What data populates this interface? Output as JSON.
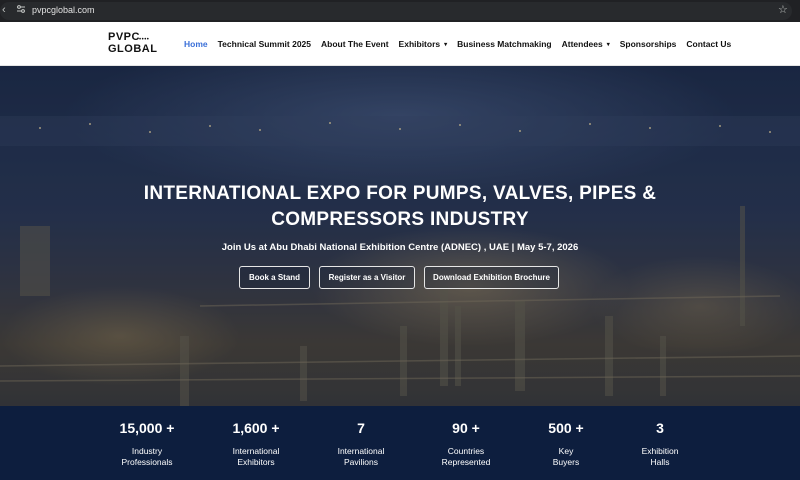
{
  "browser": {
    "url": "pvpcglobal.com"
  },
  "logo": {
    "line1": "PVPC",
    "dots": "••••",
    "line2": "GLOBAL"
  },
  "nav": {
    "items": [
      {
        "label": "Home",
        "active": true
      },
      {
        "label": "Technical Summit 2025"
      },
      {
        "label": "About The Event"
      },
      {
        "label": "Exhibitors",
        "dropdown": true
      },
      {
        "label": "Business Matchmaking"
      },
      {
        "label": "Attendees",
        "dropdown": true
      },
      {
        "label": "Sponsorships"
      },
      {
        "label": "Contact Us"
      }
    ],
    "caret": "▾"
  },
  "hero": {
    "title_line1": "INTERNATIONAL EXPO FOR PUMPS, VALVES, PIPES &",
    "title_line2": "COMPRESSORS INDUSTRY",
    "subtitle": "Join Us at Abu Dhabi National Exhibition Centre (ADNEC) , UAE | May 5-7, 2026",
    "buttons": [
      "Book a Stand",
      "Register as a Visitor",
      "Download Exhibition Brochure"
    ]
  },
  "stats": [
    {
      "value": "15,000 +",
      "label_line1": "Industry",
      "label_line2": "Professionals"
    },
    {
      "value": "1,600 +",
      "label_line1": "International",
      "label_line2": "Exhibitors"
    },
    {
      "value": "7",
      "label_line1": "International",
      "label_line2": "Pavilions"
    },
    {
      "value": "90 +",
      "label_line1": "Countries",
      "label_line2": "Represented"
    },
    {
      "value": "500 +",
      "label_line1": "Key",
      "label_line2": "Buyers"
    },
    {
      "value": "3",
      "label_line1": "Exhibition",
      "label_line2": "Halls"
    }
  ],
  "colors": {
    "nav_active": "#3a6fd8",
    "stats_bg": "#0d1e3e",
    "chrome_bg": "#202124"
  },
  "icons": [
    "back-icon",
    "site-settings-icon",
    "bookmark-star-icon"
  ]
}
